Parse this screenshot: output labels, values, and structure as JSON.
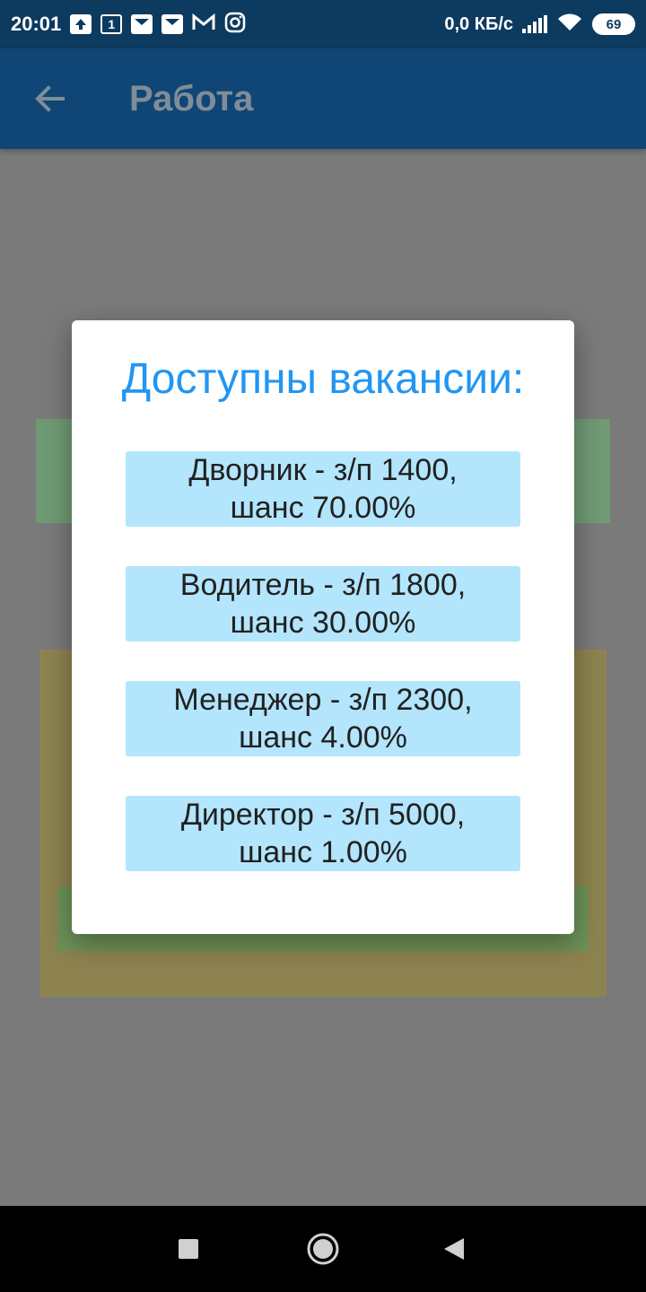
{
  "status_bar": {
    "time": "20:01",
    "net_speed": "0,0 КБ/с",
    "battery": "69",
    "notification_icons": [
      "upload-icon",
      "calendar-icon",
      "mail-icon",
      "mail-icon",
      "gmail-icon",
      "instagram-icon"
    ],
    "calendar_day": "1"
  },
  "app_bar": {
    "title": "Работа",
    "accent_color": "#0f4675"
  },
  "dialog": {
    "title": "Доступны вакансии:",
    "title_color": "#2196f3",
    "item_color": "#b3e5fc",
    "vacancies": [
      {
        "label": "Дворник - з/п 1400,\nшанс 70.00%"
      },
      {
        "label": "Водитель - з/п 1800,\nшанс 30.00%"
      },
      {
        "label": "Менеджер - з/п 2300,\nшанс 4.00%"
      },
      {
        "label": "Директор - з/п 5000,\nшанс 1.00%"
      }
    ]
  },
  "nav_bar": {
    "buttons": [
      "recent-apps-icon",
      "home-icon",
      "back-icon"
    ]
  }
}
